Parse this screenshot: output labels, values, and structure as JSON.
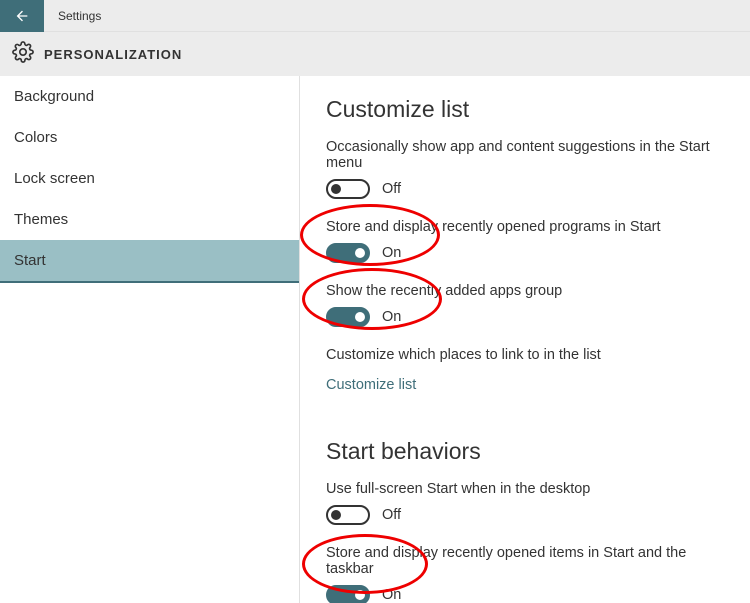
{
  "header": {
    "title": "Settings"
  },
  "category": "PERSONALIZATION",
  "sidebar": {
    "items": [
      {
        "label": "Background"
      },
      {
        "label": "Colors"
      },
      {
        "label": "Lock screen"
      },
      {
        "label": "Themes"
      },
      {
        "label": "Start"
      }
    ],
    "selected": 4
  },
  "sections": {
    "customize_list": {
      "heading": "Customize list",
      "suggestions_label": "Occasionally show app and content suggestions in the Start menu",
      "suggestions_state": "Off",
      "recent_programs_label": "Store and display recently opened programs in Start",
      "recent_programs_state": "On",
      "recently_added_label": "Show the recently added apps group",
      "recently_added_state": "On",
      "customize_places_label": "Customize which places to link to in the list",
      "customize_link": "Customize list"
    },
    "start_behaviors": {
      "heading": "Start behaviors",
      "fullscreen_label": "Use full-screen Start when in the desktop",
      "fullscreen_state": "Off",
      "recent_items_label": "Store and display recently opened items in Start and the taskbar",
      "recent_items_state": "On"
    }
  }
}
